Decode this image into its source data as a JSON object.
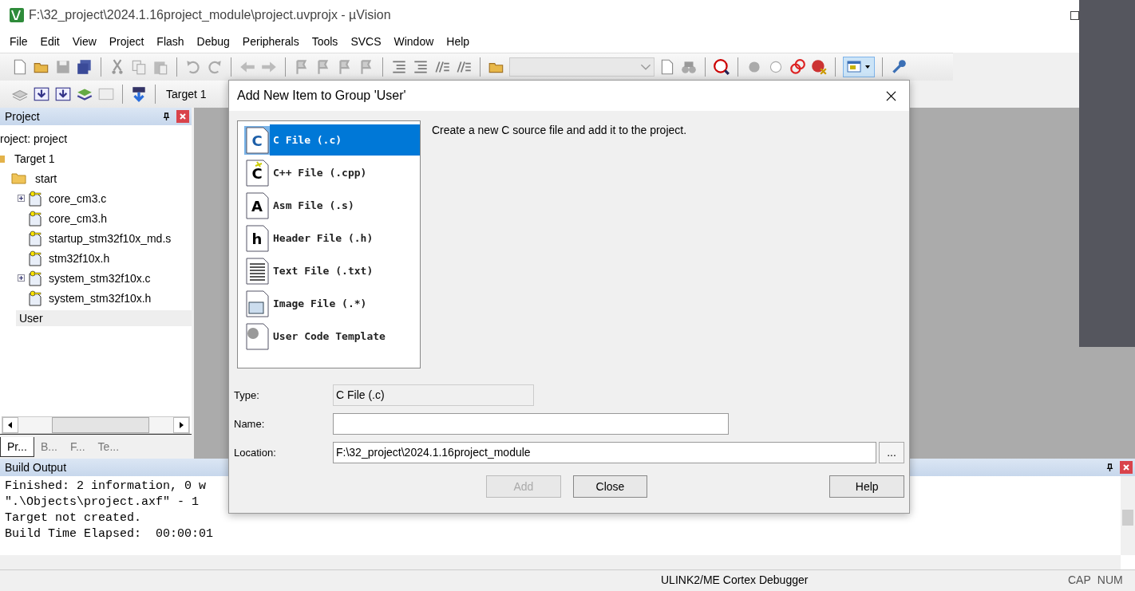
{
  "window": {
    "title": "F:\\32_project\\2024.1.16project_module\\project.uvprojx - µVision"
  },
  "menu": [
    "File",
    "Edit",
    "View",
    "Project",
    "Flash",
    "Debug",
    "Peripherals",
    "Tools",
    "SVCS",
    "Window",
    "Help"
  ],
  "build_toolbar": {
    "target": "Target 1"
  },
  "project_panel": {
    "title": "Project",
    "root": "roject: project",
    "target": "Target 1",
    "groups": [
      {
        "name": "start",
        "selected": false,
        "children": [
          {
            "name": "core_cm3.c",
            "expandable": true
          },
          {
            "name": "core_cm3.h",
            "expandable": false
          },
          {
            "name": "startup_stm32f10x_md.s",
            "expandable": false
          },
          {
            "name": "stm32f10x.h",
            "expandable": false
          },
          {
            "name": "system_stm32f10x.c",
            "expandable": true
          },
          {
            "name": "system_stm32f10x.h",
            "expandable": false
          }
        ]
      },
      {
        "name": "User",
        "selected": true
      }
    ],
    "tabs": [
      {
        "label": "Pr...",
        "selected": true
      },
      {
        "label": "B...",
        "selected": false
      },
      {
        "label": "F...",
        "selected": false
      },
      {
        "label": "Te...",
        "selected": false
      }
    ]
  },
  "build_output": {
    "title": "Build Output",
    "lines": [
      "Finished: 2 information, 0 w",
      "\".\\Objects\\project.axf\" - 1",
      "Target not created.",
      "Build Time Elapsed:  00:00:01"
    ]
  },
  "status_bar": {
    "debugger": "ULINK2/ME Cortex Debugger",
    "caps": "CAP",
    "num": "NUM"
  },
  "dialog": {
    "title": "Add New Item to Group 'User'",
    "items": [
      {
        "label": "C File (.c)",
        "selected": true,
        "icon_letter": "C"
      },
      {
        "label": "C++ File (.cpp)",
        "selected": false,
        "icon_letter": "C"
      },
      {
        "label": "Asm File (.s)",
        "selected": false,
        "icon_letter": "A"
      },
      {
        "label": "Header File (.h)",
        "selected": false,
        "icon_letter": "h"
      },
      {
        "label": "Text File (.txt)",
        "selected": false
      },
      {
        "label": "Image File (.*)",
        "selected": false
      },
      {
        "label": "User Code Template",
        "selected": false
      }
    ],
    "description": "Create a new C source file and add it to the project.",
    "type_label": "Type:",
    "type_value": "C File (.c)",
    "name_label": "Name:",
    "location_label": "Location:",
    "location_value": "F:\\32_project\\2024.1.16project_module",
    "browse": "...",
    "buttons": [
      {
        "label": "Add",
        "disabled": true
      },
      {
        "label": "Close",
        "disabled": false
      },
      {
        "label": "Help",
        "disabled": false
      }
    ]
  }
}
